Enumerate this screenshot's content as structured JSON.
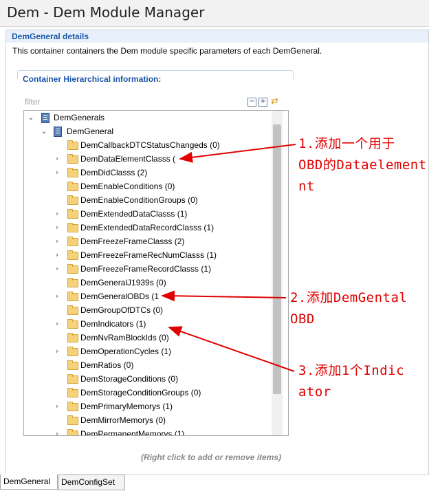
{
  "window": {
    "title": "Dem - Dem Module Manager"
  },
  "section": {
    "title": "DemGeneral details",
    "description": "This container containers the Dem module specific parameters of each DemGeneral."
  },
  "group": {
    "title": "Container Hierarchical information:"
  },
  "filter": {
    "placeholder": "filter"
  },
  "toolbar": {
    "collapse_icon": "collapse-all-icon",
    "expand_icon": "expand-all-icon",
    "sync_icon": "sync-icon"
  },
  "tree": {
    "root": "DemGenerals",
    "child": "DemGeneral",
    "items": [
      {
        "label": "DemCallbackDTCStatusChangeds (0)",
        "expandable": false
      },
      {
        "label": "DemDataElementClasss (",
        "expandable": true
      },
      {
        "label": "DemDidClasss (2)",
        "expandable": true
      },
      {
        "label": "DemEnableConditions (0)",
        "expandable": false
      },
      {
        "label": "DemEnableConditionGroups (0)",
        "expandable": false
      },
      {
        "label": "DemExtendedDataClasss (1)",
        "expandable": true
      },
      {
        "label": "DemExtendedDataRecordClasss (1)",
        "expandable": true
      },
      {
        "label": "DemFreezeFrameClasss (2)",
        "expandable": true
      },
      {
        "label": "DemFreezeFrameRecNumClasss (1)",
        "expandable": true
      },
      {
        "label": "DemFreezeFrameRecordClasss (1)",
        "expandable": true
      },
      {
        "label": "DemGeneralJ1939s (0)",
        "expandable": false
      },
      {
        "label": "DemGeneralOBDs (1",
        "expandable": true
      },
      {
        "label": "DemGroupOfDTCs (0)",
        "expandable": false
      },
      {
        "label": "DemIndicators (1)",
        "expandable": true
      },
      {
        "label": "DemNvRamBlockIds (0)",
        "expandable": false
      },
      {
        "label": "DemOperationCycles (1)",
        "expandable": true
      },
      {
        "label": "DemRatios (0)",
        "expandable": false
      },
      {
        "label": "DemStorageConditions (0)",
        "expandable": false
      },
      {
        "label": "DemStorageConditionGroups (0)",
        "expandable": false
      },
      {
        "label": "DemPrimaryMemorys (1)",
        "expandable": true
      },
      {
        "label": "DemMirrorMemorys (0)",
        "expandable": false
      },
      {
        "label": "DemPermanentMemorys (1)",
        "expandable": true
      }
    ]
  },
  "hint": "(Right click to add or remove items)",
  "tabs": [
    {
      "label": "DemGeneral",
      "active": true
    },
    {
      "label": "DemConfigSet",
      "active": false
    }
  ],
  "annotations": [
    {
      "lines": [
        "1.添加一个用于",
        "OBD的Dataelement",
        "nt"
      ]
    },
    {
      "lines": [
        "2.添加DemGental",
        "OBD"
      ]
    },
    {
      "lines": [
        "3.添加1个Indic",
        "ator"
      ]
    }
  ],
  "colors": {
    "annotation": "#e00000",
    "section_title": "#1b55a8",
    "section_bg": "#e8f1fb"
  }
}
